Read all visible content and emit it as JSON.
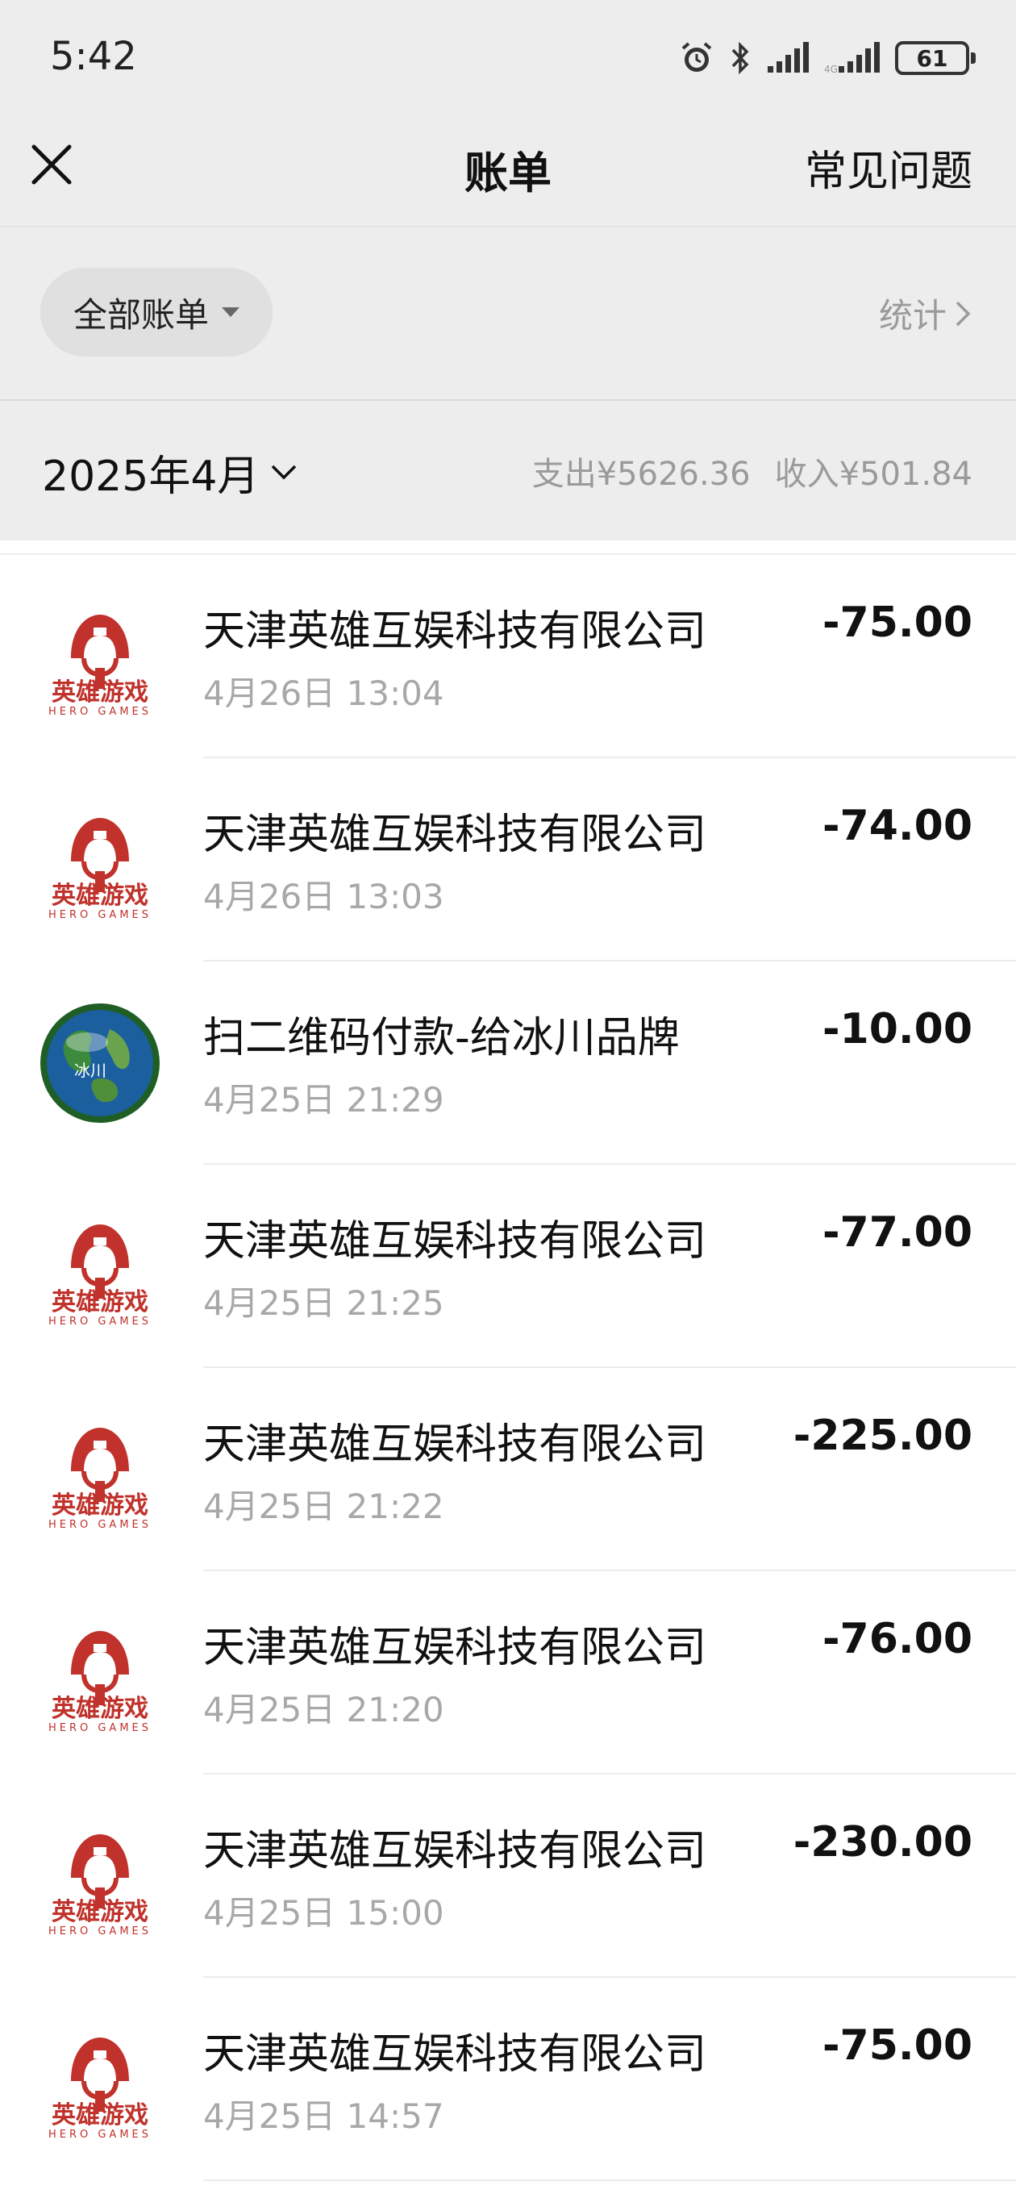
{
  "status_bar": {
    "time": "5:42",
    "battery": "61",
    "icons": [
      "alarm-icon",
      "bluetooth-icon",
      "signal-icon",
      "signal-icon",
      "battery-icon"
    ]
  },
  "nav": {
    "close_icon": "close-icon",
    "title": "账单",
    "faq": "常见问题"
  },
  "filter": {
    "label": "全部账单",
    "stats": "统计"
  },
  "month_header": {
    "month": "2025年4月",
    "expense": "支出¥5626.36",
    "income": "收入¥501.84"
  },
  "colors": {
    "header_bg": "#ededed",
    "logo_red": "#c0322b",
    "muted_text": "#9a9a9a"
  },
  "transactions": [
    {
      "name": "天津英雄互娱科技有限公司",
      "date": "4月26日 13:04",
      "amount": "-75.00",
      "icon": "hero-games-logo"
    },
    {
      "name": "天津英雄互娱科技有限公司",
      "date": "4月26日 13:03",
      "amount": "-74.00",
      "icon": "hero-games-logo"
    },
    {
      "name": "扫二维码付款-给冰川品牌",
      "date": "4月25日 21:29",
      "amount": "-10.00",
      "icon": "earth-avatar",
      "icon_text": "冰川"
    },
    {
      "name": "天津英雄互娱科技有限公司",
      "date": "4月25日 21:25",
      "amount": "-77.00",
      "icon": "hero-games-logo"
    },
    {
      "name": "天津英雄互娱科技有限公司",
      "date": "4月25日 21:22",
      "amount": "-225.00",
      "icon": "hero-games-logo"
    },
    {
      "name": "天津英雄互娱科技有限公司",
      "date": "4月25日 21:20",
      "amount": "-76.00",
      "icon": "hero-games-logo"
    },
    {
      "name": "天津英雄互娱科技有限公司",
      "date": "4月25日 15:00",
      "amount": "-230.00",
      "icon": "hero-games-logo"
    },
    {
      "name": "天津英雄互娱科技有限公司",
      "date": "4月25日 14:57",
      "amount": "-75.00",
      "icon": "hero-games-logo"
    }
  ],
  "hero_logo": {
    "text": "英雄游戏",
    "subtext": "HERO GAMES"
  }
}
